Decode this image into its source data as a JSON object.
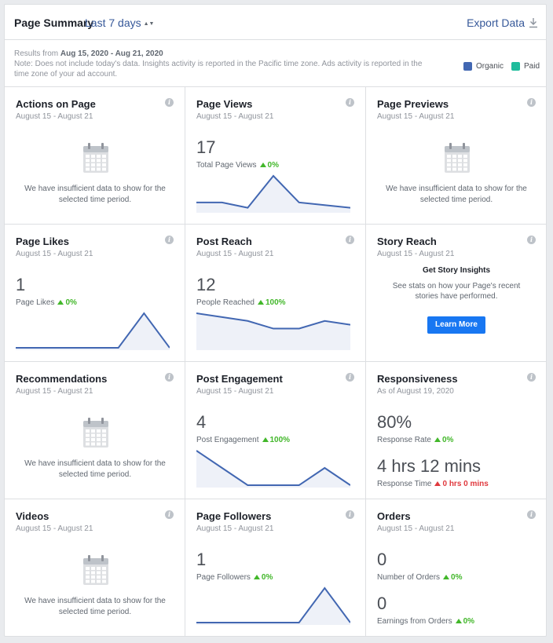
{
  "header": {
    "title": "Page Summary",
    "range_label": "Last 7 days",
    "export_label": "Export Data"
  },
  "note": {
    "results_prefix": "Results from",
    "results_range": "Aug 15, 2020 - Aug 21, 2020",
    "text": "Note: Does not include today's data. Insights activity is reported in the Pacific time zone. Ads activity is reported in the time zone of your ad account."
  },
  "legend": {
    "organic_label": "Organic",
    "paid_label": "Paid",
    "organic_color": "#4267b2",
    "paid_color": "#1fbc9c"
  },
  "empty_text": "We have insufficient data to show for the selected time period.",
  "cards": {
    "actions": {
      "title": "Actions on Page",
      "sub": "August 15 - August 21"
    },
    "page_views": {
      "title": "Page Views",
      "sub": "August 15 - August 21",
      "value": "17",
      "metric_label": "Total Page Views",
      "change": "0%",
      "spark": [
        3,
        3,
        1,
        13,
        3,
        2,
        1
      ]
    },
    "page_previews": {
      "title": "Page Previews",
      "sub": "August 15 - August 21"
    },
    "page_likes": {
      "title": "Page Likes",
      "sub": "August 15 - August 21",
      "value": "1",
      "metric_label": "Page Likes",
      "change": "0%",
      "spark": [
        0,
        0,
        0,
        0,
        0,
        1,
        0
      ]
    },
    "post_reach": {
      "title": "Post Reach",
      "sub": "August 15 - August 21",
      "value": "12",
      "metric_label": "People Reached",
      "change": "100%",
      "spark": [
        9,
        8,
        7,
        5,
        5,
        7,
        6
      ]
    },
    "story_reach": {
      "title": "Story Reach",
      "sub": "August 15 - August 21",
      "cta_title": "Get Story Insights",
      "cta_text": "See stats on how your Page's recent stories have performed.",
      "button": "Learn More"
    },
    "recommendations": {
      "title": "Recommendations",
      "sub": "August 15 - August 21"
    },
    "post_engagement": {
      "title": "Post Engagement",
      "sub": "August 15 - August 21",
      "value": "4",
      "metric_label": "Post Engagement",
      "change": "100%",
      "spark": [
        2,
        1,
        0,
        0,
        0,
        1,
        0
      ]
    },
    "responsiveness": {
      "title": "Responsiveness",
      "sub": "As of August 19, 2020",
      "rate_value": "80%",
      "rate_label": "Response Rate",
      "rate_change": "0%",
      "time_value": "4 hrs 12 mins",
      "time_label": "Response Time",
      "time_change": "0 hrs 0 mins"
    },
    "videos": {
      "title": "Videos",
      "sub": "August 15 - August 21"
    },
    "page_followers": {
      "title": "Page Followers",
      "sub": "August 15 - August 21",
      "value": "1",
      "metric_label": "Page Followers",
      "change": "0%",
      "spark": [
        0,
        0,
        0,
        0,
        0,
        1,
        0
      ]
    },
    "orders": {
      "title": "Orders",
      "sub": "August 15 - August 21",
      "orders_value": "0",
      "orders_label": "Number of Orders",
      "orders_change": "0%",
      "earnings_value": "0",
      "earnings_label": "Earnings from Orders",
      "earnings_change": "0%"
    }
  }
}
